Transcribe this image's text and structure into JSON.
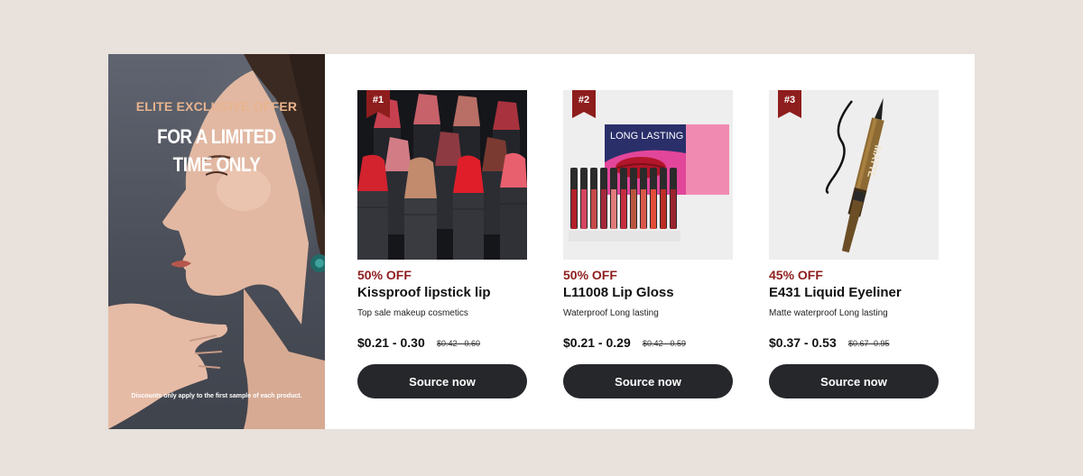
{
  "promo": {
    "eyebrow": "ELITE EXCLUSIVE OFFER",
    "headline_line1": "FOR A LIMITED",
    "headline_line2": "TIME ONLY",
    "disclaimer": "Discounts only apply to the first sample of each product."
  },
  "products": [
    {
      "rank": "#1",
      "discount": "50% OFF",
      "name": "Kissproof lipstick lip",
      "description": "Top sale makeup cosmetics",
      "price": "$0.21 - 0.30",
      "original_price": "$0.42 - 0.60",
      "button_label": "Source now"
    },
    {
      "rank": "#2",
      "discount": "50% OFF",
      "name": "L11008 Lip Gloss",
      "description": "Waterproof Long lasting",
      "price": "$0.21 - 0.29",
      "original_price": "$0.42 - 0.59",
      "button_label": "Source now",
      "box_text": "LONG LASTING"
    },
    {
      "rank": "#3",
      "discount": "45% OFF",
      "name": "E431 Liquid Eyeliner",
      "description": "Matte waterproof Long lasting",
      "price": "$0.37 - 0.53",
      "original_price": "$0.67- 0.95",
      "button_label": "Source now",
      "pen_text": "MATTE"
    }
  ],
  "colors": {
    "page_background": "#e8e1dc",
    "accent_red": "#8e1d1d",
    "promo_gold": "#e8b48e",
    "button_dark": "#26272b"
  }
}
